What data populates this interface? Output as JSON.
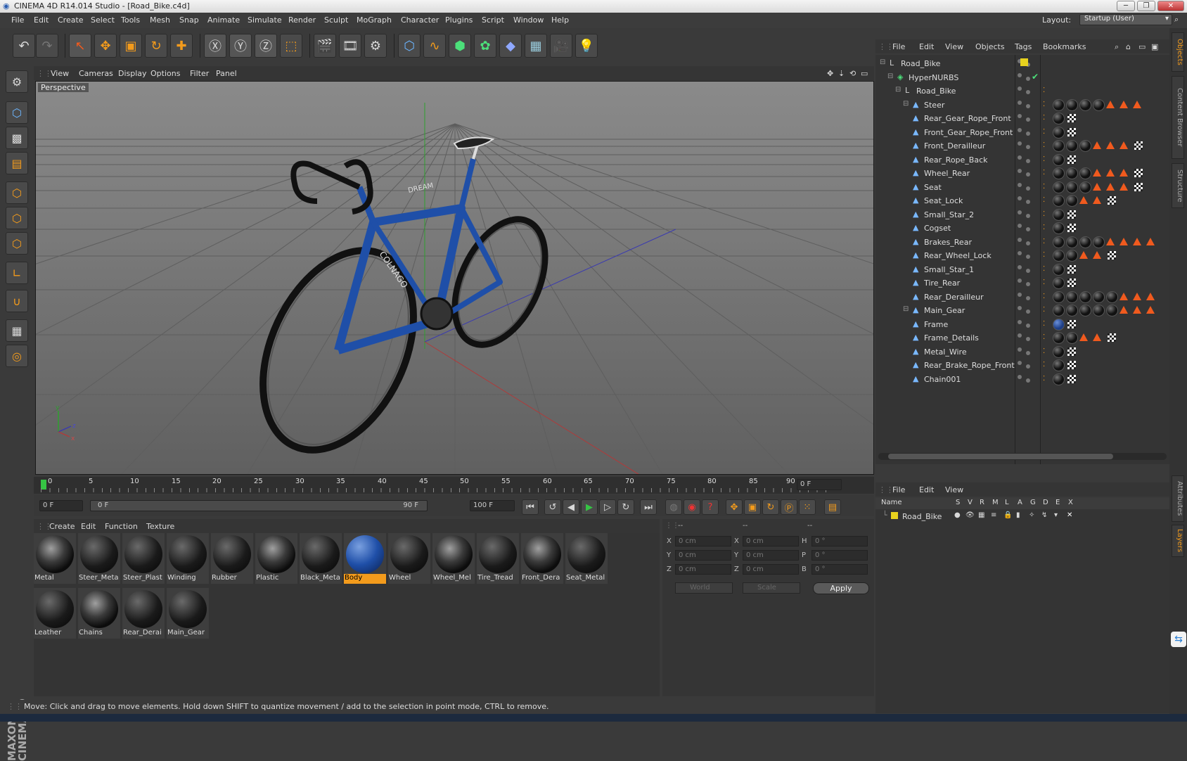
{
  "window": {
    "title": "CINEMA 4D R14.014 Studio - [Road_Bike.c4d]",
    "minimize_label": "─",
    "maximize_label": "❐",
    "close_label": "✕"
  },
  "menubar": {
    "items": [
      "File",
      "Edit",
      "Create",
      "Select",
      "Tools",
      "Mesh",
      "Snap",
      "Animate",
      "Simulate",
      "Render",
      "Sculpt",
      "MoGraph",
      "Character",
      "Plugins",
      "Script",
      "Window",
      "Help"
    ],
    "layout_label": "Layout:",
    "layout_value": "Startup (User)"
  },
  "viewport": {
    "menu": [
      "View",
      "Cameras",
      "Display",
      "Options",
      "Filter",
      "Panel"
    ],
    "camera_label": "Perspective",
    "axis_x": "x",
    "axis_y": "y",
    "axis_z": "z",
    "decal_brand": "COLNAGO",
    "decal_model": "DREAM"
  },
  "timeline": {
    "ticks": [
      "0",
      "5",
      "10",
      "15",
      "20",
      "25",
      "30",
      "35",
      "40",
      "45",
      "50",
      "55",
      "60",
      "65",
      "70",
      "75",
      "80",
      "85",
      "90"
    ],
    "current_frame": "0 F",
    "start_field": "0 F",
    "range_start": "0 F",
    "range_end": "90 F",
    "end_field": "100 F"
  },
  "materials": {
    "menu": [
      "Create",
      "Edit",
      "Function",
      "Texture"
    ],
    "items": [
      {
        "name": "Metal",
        "style": "hdr"
      },
      {
        "name": "Steer_Meta",
        "style": "dark"
      },
      {
        "name": "Steer_Plast",
        "style": "dark"
      },
      {
        "name": "Winding",
        "style": "dark"
      },
      {
        "name": "Rubber",
        "style": "dark"
      },
      {
        "name": "Plastic",
        "style": "hdr"
      },
      {
        "name": "Black_Meta",
        "style": "dark"
      },
      {
        "name": "Body",
        "style": "blue",
        "selected": true
      },
      {
        "name": "Wheel",
        "style": "dark"
      },
      {
        "name": "Wheel_Mel",
        "style": "hdr"
      },
      {
        "name": "Tire_Tread",
        "style": "dark"
      },
      {
        "name": "Front_Dera",
        "style": "hdr"
      },
      {
        "name": "Seat_Metal",
        "style": "dark"
      },
      {
        "name": "Leather",
        "style": "dark"
      },
      {
        "name": "Chains",
        "style": "hdr"
      },
      {
        "name": "Rear_Derai",
        "style": "dark"
      },
      {
        "name": "Main_Gear",
        "style": "dark"
      }
    ]
  },
  "coords": {
    "header": [
      "--",
      "--",
      "--"
    ],
    "rows": [
      {
        "a": "X",
        "av": "0 cm",
        "b": "X",
        "bv": "0 cm",
        "c": "H",
        "cv": "0 °"
      },
      {
        "a": "Y",
        "av": "0 cm",
        "b": "Y",
        "bv": "0 cm",
        "c": "P",
        "cv": "0 °"
      },
      {
        "a": "Z",
        "av": "0 cm",
        "b": "Z",
        "bv": "0 cm",
        "c": "B",
        "cv": "0 °"
      }
    ],
    "space": "World",
    "mode": "Scale",
    "apply": "Apply"
  },
  "status": {
    "text": "Move: Click and drag to move elements. Hold down SHIFT to quantize movement / add to the selection in point mode, CTRL to remove."
  },
  "objects": {
    "menu": [
      "File",
      "Edit",
      "View",
      "Objects",
      "Tags",
      "Bookmarks"
    ],
    "rows": [
      {
        "name": "Road_Bike",
        "depth": 0,
        "tags": "yellow"
      },
      {
        "name": "HyperNURBS",
        "depth": 1,
        "tags": "check"
      },
      {
        "name": "Road_Bike",
        "depth": 2,
        "tags": ""
      },
      {
        "name": "Steer",
        "depth": 3,
        "tags": "bbbbttt"
      },
      {
        "name": "Rear_Gear_Rope_Front",
        "depth": 3,
        "tags": "bc"
      },
      {
        "name": "Front_Gear_Rope_Front",
        "depth": 3,
        "tags": "bc"
      },
      {
        "name": "Front_Derailleur",
        "depth": 3,
        "tags": "bbbtttc"
      },
      {
        "name": "Rear_Rope_Back",
        "depth": 3,
        "tags": "bc"
      },
      {
        "name": "Wheel_Rear",
        "depth": 3,
        "tags": "bbbtttc"
      },
      {
        "name": "Seat",
        "depth": 3,
        "tags": "bbbtttc"
      },
      {
        "name": "Seat_Lock",
        "depth": 3,
        "tags": "bbttc"
      },
      {
        "name": "Small_Star_2",
        "depth": 3,
        "tags": "bc"
      },
      {
        "name": "Cogset",
        "depth": 3,
        "tags": "bc"
      },
      {
        "name": "Brakes_Rear",
        "depth": 3,
        "tags": "bbbbtttt"
      },
      {
        "name": "Rear_Wheel_Lock",
        "depth": 3,
        "tags": "bbttc"
      },
      {
        "name": "Small_Star_1",
        "depth": 3,
        "tags": "bc"
      },
      {
        "name": "Tire_Rear",
        "depth": 3,
        "tags": "bc"
      },
      {
        "name": "Rear_Derailleur",
        "depth": 3,
        "tags": "bbbbbttt"
      },
      {
        "name": "Main_Gear",
        "depth": 3,
        "tags": "bbbbbttt"
      },
      {
        "name": "Frame",
        "depth": 3,
        "tags": "Bc"
      },
      {
        "name": "Frame_Details",
        "depth": 3,
        "tags": "bbttc"
      },
      {
        "name": "Metal_Wire",
        "depth": 3,
        "tags": "bc"
      },
      {
        "name": "Rear_Brake_Rope_Front",
        "depth": 3,
        "tags": "bc"
      },
      {
        "name": "Chain001",
        "depth": 3,
        "tags": "bc"
      }
    ]
  },
  "layers": {
    "menu": [
      "File",
      "Edit",
      "View"
    ],
    "columns": [
      "Name",
      "S",
      "V",
      "R",
      "M",
      "L",
      "A",
      "G",
      "D",
      "E",
      "X"
    ],
    "rows": [
      {
        "name": "Road_Bike"
      }
    ]
  },
  "sidetabs": [
    "Objects",
    "Content Browser",
    "Structure",
    "Attributes",
    "Layers"
  ],
  "colors": {
    "accent": "#f39b1c",
    "object_icon": "#79b8ff",
    "tag_triangle": "#f05a1e"
  }
}
